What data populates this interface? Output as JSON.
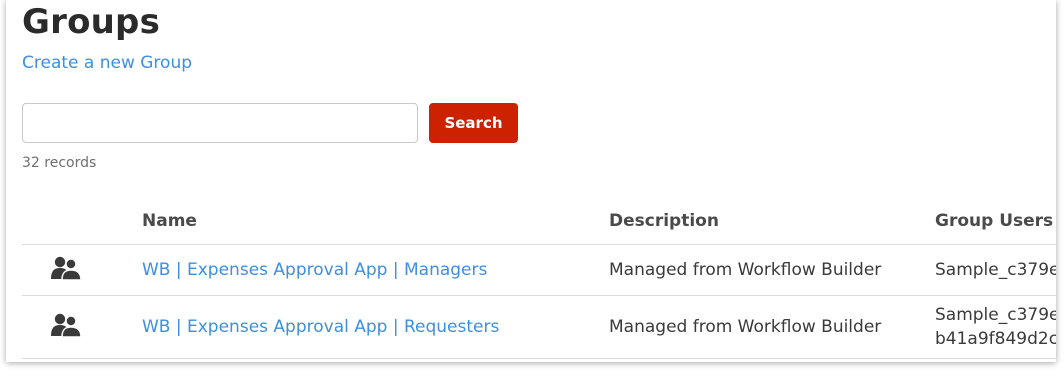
{
  "page": {
    "title": "Groups",
    "create_link": "Create a new Group"
  },
  "search": {
    "value": "",
    "placeholder": "",
    "button_label": "Search"
  },
  "records_label": "32 records",
  "table": {
    "headers": {
      "icon": "",
      "name": "Name",
      "description": "Description",
      "users": "Group Users"
    },
    "rows": [
      {
        "icon": "group-icon",
        "name": "WB | Expenses Approval App | Managers",
        "description": "Managed from Workflow Builder",
        "users": [
          "Sample_c379e"
        ]
      },
      {
        "icon": "group-icon",
        "name": "WB | Expenses Approval App | Requesters",
        "description": "Managed from Workflow Builder",
        "users": [
          "Sample_c379e",
          "b41a9f849d2c"
        ]
      }
    ]
  },
  "colors": {
    "link": "#3d8fe0",
    "button": "#cc2200",
    "title": "#2b2b2b"
  }
}
